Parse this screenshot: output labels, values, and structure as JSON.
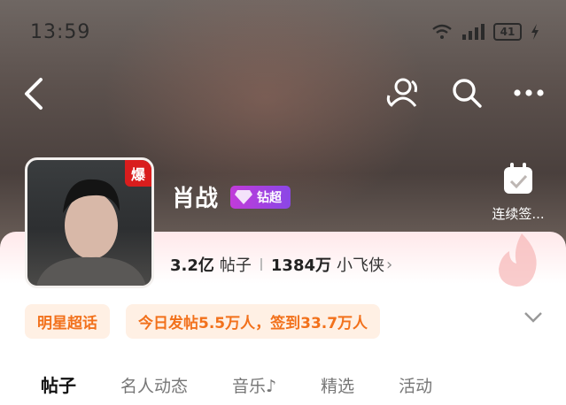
{
  "status_bar": {
    "time": "13:59",
    "battery": "41",
    "icons": [
      "wifi-icon",
      "signal-icon",
      "battery-icon",
      "charging-icon"
    ]
  },
  "nav": {
    "icons": [
      "back-icon",
      "members-icon",
      "search-icon",
      "more-icon"
    ]
  },
  "profile": {
    "name": "肖战",
    "avatar_badge": "爆",
    "vip_badge": "钻超",
    "checkin_label": "连续签...",
    "posts_count": "3.2亿",
    "posts_unit": "帖子",
    "fans_count": "1384万",
    "fans_unit": "小飞侠"
  },
  "tags": {
    "category": "明星超话",
    "summary": "今日发帖5.5万人，签到33.7万人"
  },
  "tabs": [
    "帖子",
    "名人动态",
    "音乐♪",
    "精选",
    "活动"
  ],
  "colors": {
    "tag_text": "#f2711c",
    "tag_bg": "#fff0e4",
    "vip_gradient_start": "#c13bd9",
    "vip_gradient_end": "#8a47e6",
    "badge_red": "#d91d1d"
  }
}
